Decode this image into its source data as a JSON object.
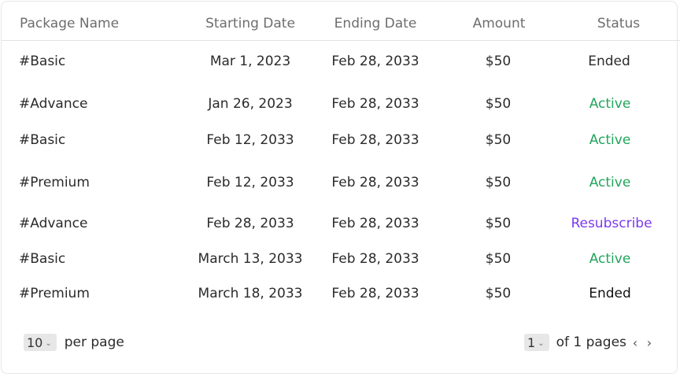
{
  "table": {
    "headers": {
      "package_name": "Package Name",
      "starting_date": "Starting Date",
      "ending_date": "Ending Date",
      "amount": "Amount",
      "status": "Status"
    },
    "rows": [
      {
        "name": "#Basic",
        "start": "Mar 1, 2023",
        "end": "Feb 28, 2033",
        "amount": "$50",
        "status": "Ended"
      },
      {
        "name": "#Advance",
        "start": "Jan 26, 2023",
        "end": "Feb 28, 2033",
        "amount": "$50",
        "status": "Active"
      },
      {
        "name": "#Basic",
        "start": "Feb 12, 2033",
        "end": "Feb 28, 2033",
        "amount": "$50",
        "status": "Active"
      },
      {
        "name": "#Premium",
        "start": "Feb 12, 2033",
        "end": "Feb 28, 2033",
        "amount": "$50",
        "status": "Active"
      },
      {
        "name": "#Advance",
        "start": "Feb 28, 2033",
        "end": "Feb 28, 2033",
        "amount": "$50",
        "status": "Resubscribe"
      },
      {
        "name": "#Basic",
        "start": "March 13, 2033",
        "end": "Feb 28, 2033",
        "amount": "$50",
        "status": "Active"
      },
      {
        "name": "#Premium",
        "start": "March 18, 2033",
        "end": "Feb 28, 2033",
        "amount": "$50",
        "status": "Ended"
      }
    ]
  },
  "pagination": {
    "per_page_value": "10",
    "per_page_label": "per page",
    "current_page": "1",
    "pages_label": "of 1 pages"
  },
  "icons": {
    "dropdown": "chevron-down-icon",
    "prev": "chevron-left-icon",
    "next": "chevron-right-icon"
  },
  "colors": {
    "active": "#22a55b",
    "resubscribe": "#7c3aed",
    "ended": "#2b2b2b"
  }
}
